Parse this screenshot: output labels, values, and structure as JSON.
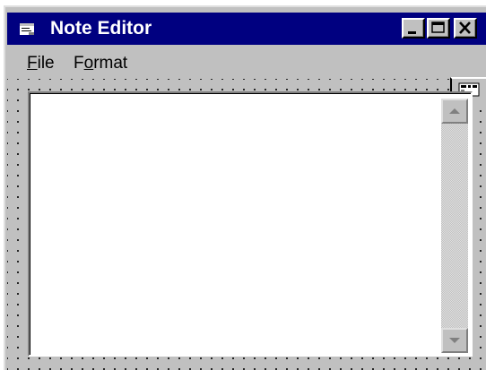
{
  "window": {
    "title": "Note Editor",
    "title_bar_color": "#000080",
    "icon": "notepad-icon"
  },
  "title_buttons": {
    "minimize_icon": "minimize-icon",
    "maximize_icon": "maximize-icon",
    "close_icon": "close-icon"
  },
  "menu": {
    "items": [
      {
        "label_accel": "F",
        "label_rest": "ile"
      },
      {
        "label_pre": "F",
        "label_accel": "o",
        "label_rest": "rmat"
      }
    ]
  },
  "editor": {
    "text": "",
    "scroll_up_icon": "scroll-up-arrow-icon",
    "scroll_down_icon": "scroll-down-arrow-icon"
  },
  "toolbox": {
    "icon": "rich-textbox-control-icon"
  },
  "colors": {
    "face": "#c0c0c0",
    "window_bg": "#ffffff"
  }
}
